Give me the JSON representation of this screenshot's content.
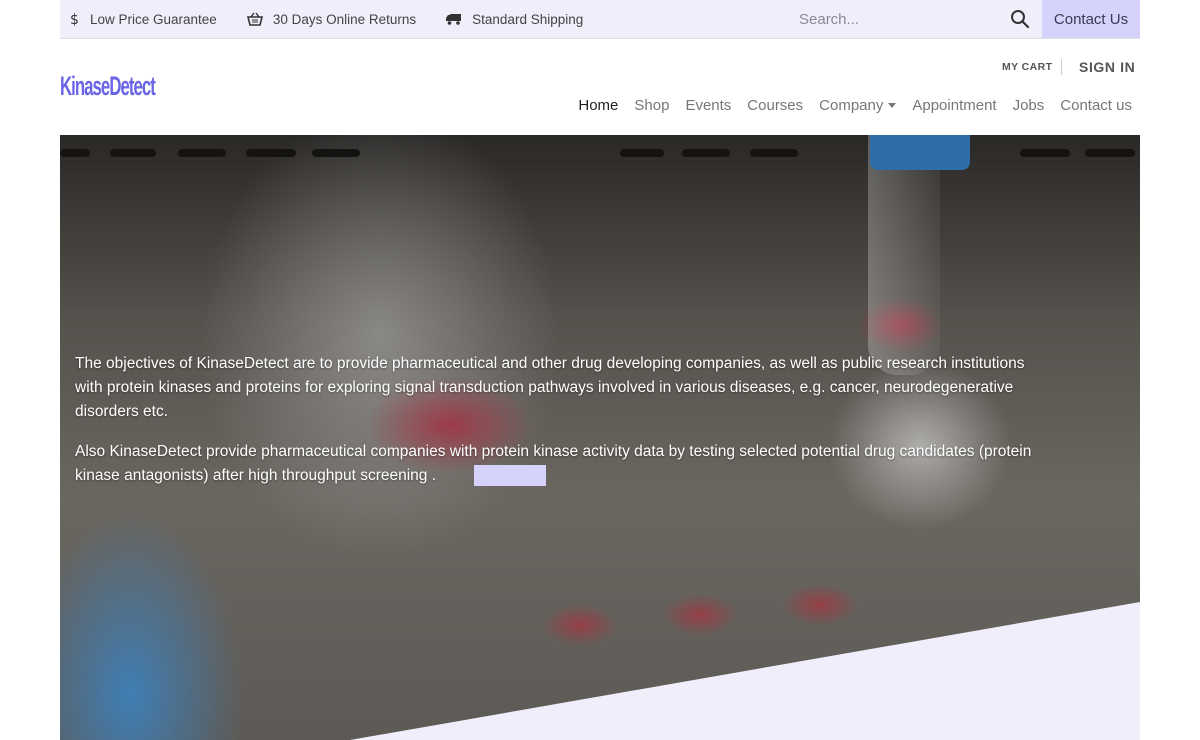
{
  "topbar": {
    "items": [
      {
        "label": "Low Price Guarantee",
        "icon": "dollar-icon"
      },
      {
        "label": "30 Days Online Returns",
        "icon": "basket-icon"
      },
      {
        "label": "Standard Shipping",
        "icon": "truck-icon"
      }
    ],
    "search_placeholder": "Search...",
    "contact_label": "Contact Us"
  },
  "header": {
    "logo_text": "KinaseDetect",
    "my_cart": "MY CART",
    "sign_in": "SIGN IN",
    "nav": [
      {
        "label": "Home",
        "active": true
      },
      {
        "label": "Shop"
      },
      {
        "label": "Events"
      },
      {
        "label": "Courses"
      },
      {
        "label": "Company",
        "dropdown": true
      },
      {
        "label": "Appointment"
      },
      {
        "label": "Jobs"
      },
      {
        "label": "Contact us"
      }
    ]
  },
  "hero": {
    "paragraph1": "The objectives of KinaseDetect are to provide pharmaceutical and other drug developing companies, as well as public research institutions with protein kinases and proteins for exploring signal transduction pathways involved in various diseases, e.g. cancer, neurodegenerative disorders etc.",
    "paragraph2": "Also KinaseDetect provide pharmaceutical companies with protein kinase activity data by testing selected potential drug candidates (protein kinase antagonists) after high throughput screening ."
  },
  "colors": {
    "accent": "#d5d2fb",
    "topbar_bg": "#efeefa",
    "logo": "#6a64e6",
    "diagonal": "#efeefa"
  }
}
